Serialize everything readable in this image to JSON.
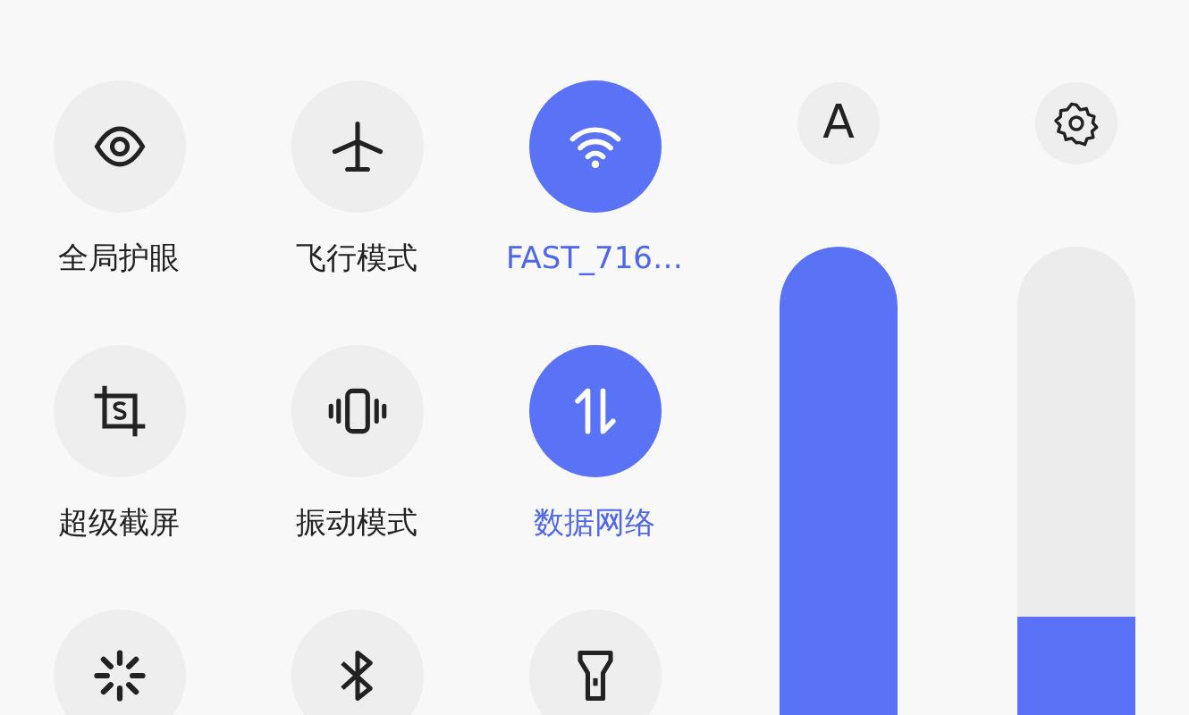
{
  "tiles": [
    {
      "label": "全局护眼",
      "on": false
    },
    {
      "label": "飞行模式",
      "on": false
    },
    {
      "label": "FAST_716…",
      "on": true
    },
    {
      "label": "超级截屏",
      "on": false
    },
    {
      "label": "振动模式",
      "on": false
    },
    {
      "label": "数据网络",
      "on": true
    },
    {
      "on": false
    },
    {
      "on": false
    },
    {
      "on": false
    }
  ],
  "sliders": [
    {
      "kind": "brightness",
      "symbol": "A",
      "level": 1
    },
    {
      "kind": "volume",
      "level": 0.21
    }
  ]
}
